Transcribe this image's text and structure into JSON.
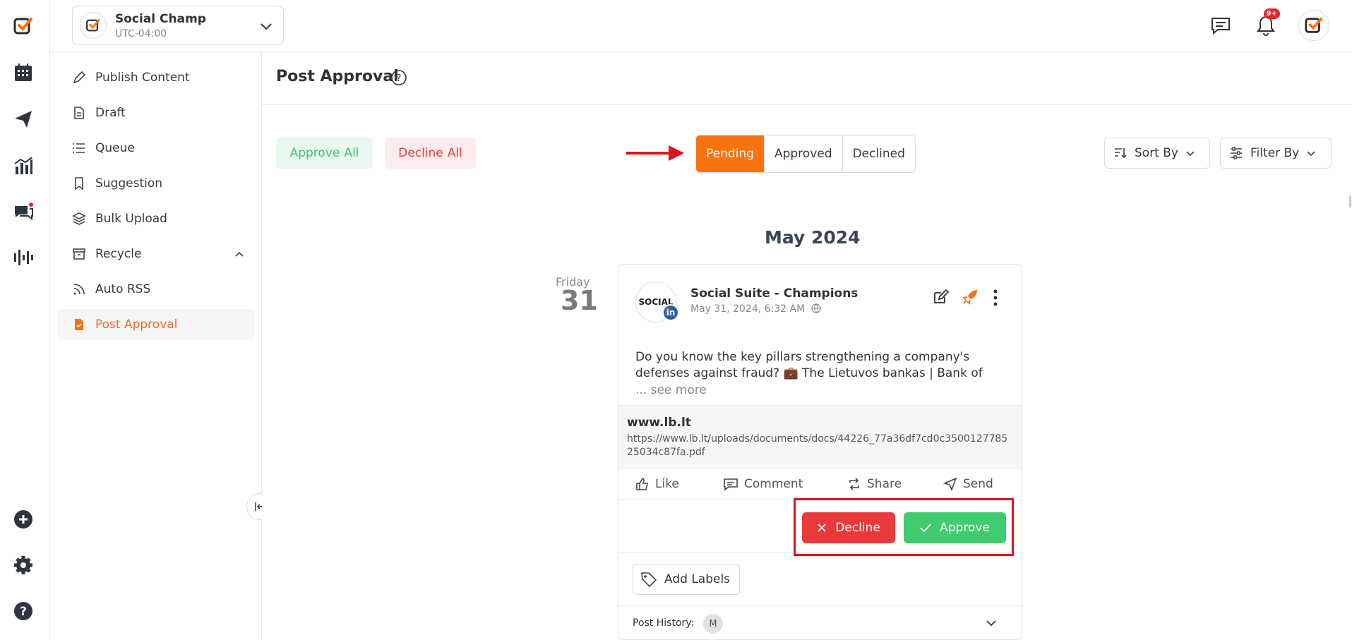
{
  "account": {
    "name": "Social Champ",
    "timezone": "UTC-04:00"
  },
  "notifications": {
    "badge": "9+"
  },
  "sidebar": {
    "items": [
      {
        "label": "Publish Content"
      },
      {
        "label": "Draft"
      },
      {
        "label": "Queue"
      },
      {
        "label": "Suggestion"
      },
      {
        "label": "Bulk Upload"
      },
      {
        "label": "Recycle"
      },
      {
        "label": "Auto RSS"
      },
      {
        "label": "Post Approval"
      }
    ]
  },
  "page": {
    "title": "Post Approval"
  },
  "bulk": {
    "approve": "Approve",
    "approve_all": "All",
    "decline": "Decline",
    "decline_all": "All"
  },
  "tabs": [
    {
      "label": "Pending",
      "active": true
    },
    {
      "label": "Approved"
    },
    {
      "label": "Declined"
    }
  ],
  "sort": {
    "label": "Sort By"
  },
  "filter": {
    "label": "Filter By"
  },
  "month": "May 2024",
  "day": {
    "name": "Friday",
    "number": "31"
  },
  "post": {
    "logo_text": "SOCIAL",
    "network_badge": "in",
    "account_name": "Social Suite - Champions",
    "date": "May 31, 2024, 6:32 AM",
    "body_line1": "Do you know the key pillars strengthening a company's",
    "body_line2": "defenses against fraud? 💼 The Lietuvos bankas | Bank of",
    "see_more": "... see more",
    "link_domain": "www.lb.lt",
    "link_url": "https://www.lb.lt/uploads/documents/docs/44226_77a36df7cd0c350012778525034c87fa.pdf",
    "actions": {
      "like": "Like",
      "comment": "Comment",
      "share": "Share",
      "send": "Send"
    },
    "decline": "Decline",
    "approve": "Approve",
    "add_labels": "Add Labels",
    "history_label": "Post History:",
    "history_avatar": "M"
  },
  "colors": {
    "brand": "#f7730e",
    "approve": "#3fcb6e",
    "decline": "#e8393c",
    "highlight": "#d9151e"
  }
}
